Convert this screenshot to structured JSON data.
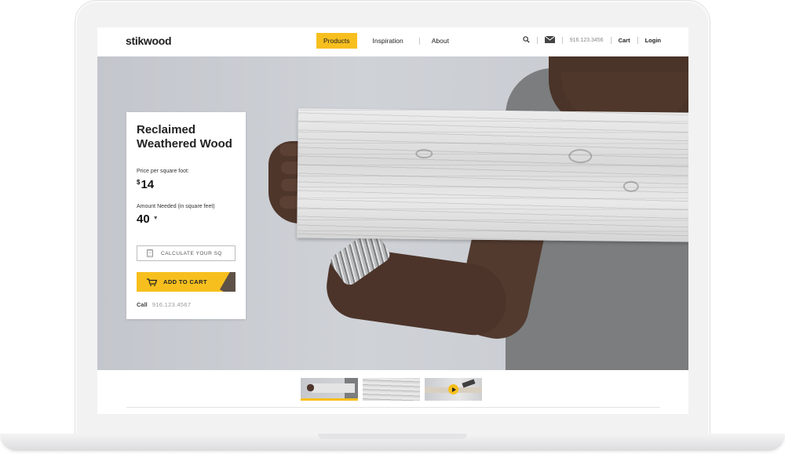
{
  "header": {
    "logo": "stikwood",
    "nav": [
      {
        "label": "Products",
        "active": true
      },
      {
        "label": "Inspiration",
        "active": false
      },
      {
        "label": "About",
        "active": false
      }
    ],
    "search_icon": "search-icon",
    "mail_icon": "mail-icon",
    "phone": "916.123.3456",
    "cart_label": "Cart",
    "login_label": "Login"
  },
  "product": {
    "title": "Reclaimed Weathered Wood",
    "price_label": "Price per square foot:",
    "price_currency": "$",
    "price_value": "14",
    "amount_label": "Amount Needed (in square feet)",
    "amount_value": "40",
    "calculate_label": "CALCULATE YOUR SQ",
    "add_to_cart_label": "ADD TO CART",
    "call_label": "Call",
    "call_number": "916.123.4567"
  },
  "thumbnails": [
    {
      "name": "product-photo-person",
      "selected": true
    },
    {
      "name": "wood-texture",
      "selected": false
    },
    {
      "name": "video-installation",
      "selected": false,
      "has_play": true
    }
  ],
  "colors": {
    "accent": "#f7bf1e",
    "text": "#222222",
    "hero_bg": "#c9ccd1"
  }
}
